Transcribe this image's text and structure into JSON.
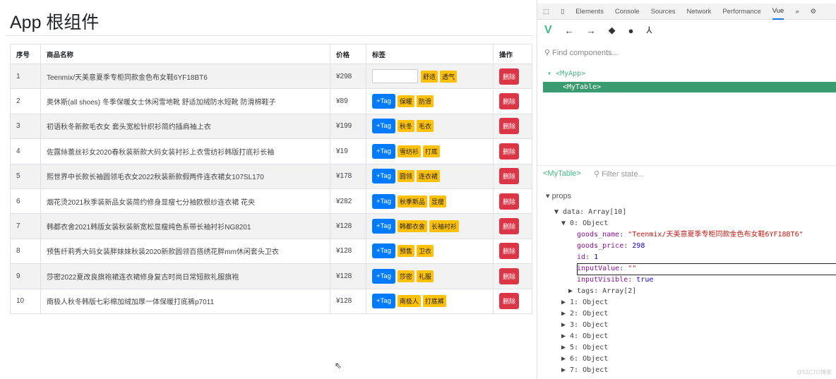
{
  "page": {
    "title": "App 根组件"
  },
  "table": {
    "headers": [
      "序号",
      "商品名称",
      "价格",
      "标签",
      "操作"
    ],
    "add_tag_label": "+Tag",
    "delete_label": "删除",
    "rows": [
      {
        "id": "1",
        "name": "Teenmix/天美意夏季专柜同款金色布女鞋6YF18BT6",
        "price": "¥298",
        "tags": [
          "舒适",
          "透气"
        ],
        "input_visible": true
      },
      {
        "id": "2",
        "name": "奥休斯(all shoes) 冬季保暖女士休闲雪地靴 舒适加绒防水短靴 防滑棉鞋子",
        "price": "¥89",
        "tags": [
          "保暖",
          "防滑"
        ]
      },
      {
        "id": "3",
        "name": "初语秋冬新款毛衣女 套头宽松针织衫简约插肩袖上衣",
        "price": "¥199",
        "tags": [
          "秋冬",
          "毛衣"
        ]
      },
      {
        "id": "4",
        "name": "佐露絲蕾丝衫女2020春秋装新款大码女装衬衫上衣雪纺衫韩版打底衫长袖",
        "price": "¥19",
        "tags": [
          "雪纺衫",
          "打底"
        ]
      },
      {
        "id": "5",
        "name": "熙世界中长款长袖圆领毛衣女2022秋装新款假两件连衣裙女107SL170",
        "price": "¥178",
        "tags": [
          "圆领",
          "连衣裙"
        ]
      },
      {
        "id": "6",
        "name": "烟花烫2021秋季装新品女装简约修身显瘦七分袖欧根纱连衣裙 花央",
        "price": "¥282",
        "tags": [
          "秋季新品",
          "显瘦"
        ]
      },
      {
        "id": "7",
        "name": "韩都衣舍2021韩版女装秋装新宽松显瘦纯色系带长袖衬衫NG8201",
        "price": "¥128",
        "tags": [
          "韩都衣舍",
          "长袖衬衫"
        ]
      },
      {
        "id": "8",
        "name": "预售纤莉秀大码女装胖妹妹秋装2020新款圆领百搭绣花胖mm休闲套头卫衣",
        "price": "¥128",
        "tags": [
          "预售",
          "卫衣"
        ]
      },
      {
        "id": "9",
        "name": "莎密2022夏改良旗袍裙连衣裙修身复古时尚日常短款礼服旗袍",
        "price": "¥128",
        "tags": [
          "莎密",
          "礼服"
        ]
      },
      {
        "id": "10",
        "name": "南极人秋冬韩版七彩棉加绒加厚一体保暖打底裤p7011",
        "price": "¥128",
        "tags": [
          "南极人",
          "打底裤"
        ]
      }
    ]
  },
  "devtools": {
    "tabs": [
      "Elements",
      "Console",
      "Sources",
      "Network",
      "Performance",
      "Vue"
    ],
    "more": "»",
    "active_tab": "Vue",
    "find_placeholder": "Find components...",
    "tree": {
      "root": "<MyApp>",
      "selected": "<MyTable>"
    },
    "inspector": {
      "component": "<MyTable>",
      "filter_placeholder": "Filter state...",
      "section": "props",
      "lines": [
        {
          "t": "▼ data: Array[10]"
        },
        {
          "t": "▼ 0: Object"
        },
        {
          "k": "goods_name",
          "v": "\"Teenmix/天美意夏季专柜同款金色布女鞋6YF18BT6\""
        },
        {
          "k": "goods_price",
          "v": "298"
        },
        {
          "k": "id",
          "v": "1"
        },
        {
          "k": "inputValue",
          "v": "\"\""
        },
        {
          "k": "inputVisible",
          "v": "true"
        },
        {
          "t": "▶ tags: Array[2]"
        },
        {
          "t": "▶ 1: Object"
        },
        {
          "t": "▶ 2: Object"
        },
        {
          "t": "▶ 3: Object"
        },
        {
          "t": "▶ 4: Object"
        },
        {
          "t": "▶ 5: Object"
        },
        {
          "t": "▶ 6: Object"
        },
        {
          "t": "▶ 7: Object"
        }
      ]
    },
    "watermark": "@51CTO博客"
  }
}
